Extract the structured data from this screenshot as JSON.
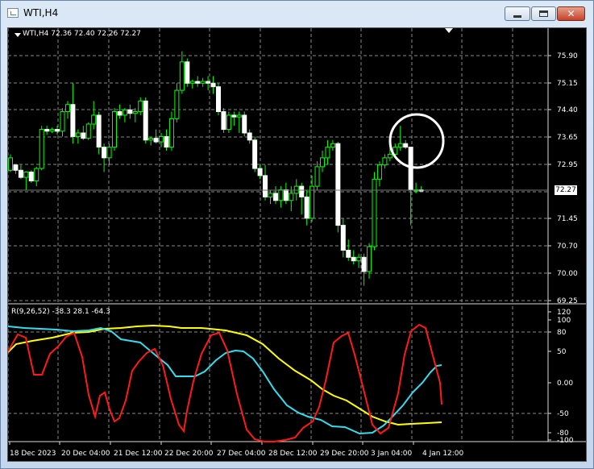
{
  "window": {
    "title": "WTI,H4"
  },
  "chart": {
    "header": "WTI,H4  72.36 72.40 72.26 72.27",
    "current_price_label": "72.27",
    "price_axis": [
      "75.90",
      "75.15",
      "74.40",
      "73.65",
      "72.95",
      "71.45",
      "70.70",
      "70.00",
      "69.25"
    ],
    "time_axis": [
      "18 Dec 2023",
      "20 Dec 04:00",
      "21 Dec 12:00",
      "22 Dec 20:00",
      "27 Dec 04:00",
      "28 Dec 12:00",
      "29 Dec 20:00",
      "3 Jan 04:00",
      "4 Jan 12:00"
    ]
  },
  "indicator": {
    "header": "R(9,26,52) -38.3 28.1 -64.3",
    "axis": [
      "120",
      "100",
      "80",
      "50",
      "0.00",
      "-50",
      "-80",
      "-100"
    ]
  },
  "colors": {
    "bull": "#00ff00",
    "bear": "#ffffff",
    "red": "#ff1a1a",
    "yellow": "#ffff00",
    "cyan": "#33ddee",
    "grid": "#8a8a8a",
    "highlight_circle": "#ffffff"
  },
  "chart_data": {
    "type": "candlestick",
    "ylim": [
      69.25,
      76.3
    ],
    "candles": [
      [
        72.85,
        73.3,
        72.8,
        73.2
      ],
      [
        73.0,
        72.96,
        72.75,
        72.85
      ],
      [
        72.85,
        73.0,
        72.6,
        72.65
      ],
      [
        72.65,
        72.82,
        72.3,
        72.8
      ],
      [
        72.8,
        72.85,
        72.5,
        72.55
      ],
      [
        72.55,
        72.95,
        72.4,
        72.9
      ],
      [
        72.9,
        74.1,
        72.85,
        74.0
      ],
      [
        74.0,
        74.1,
        73.85,
        73.95
      ],
      [
        73.95,
        74.05,
        73.9,
        74.0
      ],
      [
        74.0,
        74.1,
        73.85,
        73.95
      ],
      [
        73.95,
        74.6,
        73.8,
        74.5
      ],
      [
        74.5,
        74.8,
        74.3,
        74.7
      ],
      [
        74.7,
        75.3,
        73.6,
        73.8
      ],
      [
        73.8,
        74.0,
        73.6,
        73.9
      ],
      [
        73.9,
        74.1,
        73.7,
        73.75
      ],
      [
        73.75,
        74.2,
        73.7,
        74.15
      ],
      [
        74.15,
        74.8,
        74.0,
        74.4
      ],
      [
        74.4,
        74.5,
        73.3,
        73.5
      ],
      [
        73.5,
        73.6,
        72.8,
        73.2
      ],
      [
        73.2,
        73.6,
        73.0,
        73.5
      ],
      [
        73.5,
        74.6,
        73.4,
        74.5
      ],
      [
        74.5,
        74.7,
        74.3,
        74.4
      ],
      [
        74.4,
        74.6,
        74.2,
        74.55
      ],
      [
        74.55,
        74.7,
        74.3,
        74.45
      ],
      [
        74.45,
        74.6,
        74.2,
        74.5
      ],
      [
        74.5,
        74.9,
        74.4,
        74.8
      ],
      [
        74.8,
        74.9,
        73.6,
        73.7
      ],
      [
        73.7,
        73.8,
        73.55,
        73.75
      ],
      [
        73.75,
        74.0,
        73.6,
        73.65
      ],
      [
        73.65,
        73.9,
        73.5,
        73.8
      ],
      [
        73.8,
        74.0,
        73.4,
        73.5
      ],
      [
        73.5,
        74.5,
        73.4,
        74.3
      ],
      [
        74.3,
        75.3,
        74.2,
        75.1
      ],
      [
        75.1,
        76.2,
        75.0,
        75.9
      ],
      [
        75.9,
        76.0,
        75.2,
        75.3
      ],
      [
        75.3,
        75.4,
        75.15,
        75.35
      ],
      [
        75.35,
        75.5,
        75.2,
        75.3
      ],
      [
        75.3,
        75.45,
        75.2,
        75.35
      ],
      [
        75.35,
        75.5,
        75.1,
        75.3
      ],
      [
        75.3,
        75.5,
        75.0,
        75.2
      ],
      [
        75.2,
        75.3,
        74.4,
        74.5
      ],
      [
        74.5,
        74.6,
        73.9,
        74.0
      ],
      [
        74.0,
        74.5,
        73.9,
        74.4
      ],
      [
        74.4,
        74.5,
        74.1,
        74.35
      ],
      [
        74.35,
        74.5,
        73.9,
        74.4
      ],
      [
        74.4,
        74.5,
        73.8,
        73.9
      ],
      [
        73.9,
        74.0,
        73.6,
        73.7
      ],
      [
        73.7,
        73.8,
        72.8,
        72.9
      ],
      [
        72.9,
        73.0,
        72.6,
        72.7
      ],
      [
        72.7,
        73.0,
        72.0,
        72.1
      ],
      [
        72.1,
        72.3,
        71.9,
        72.2
      ],
      [
        72.2,
        72.4,
        71.9,
        72.0
      ],
      [
        72.0,
        72.4,
        71.8,
        72.3
      ],
      [
        72.3,
        72.5,
        71.9,
        72.0
      ],
      [
        72.0,
        72.4,
        71.7,
        72.2
      ],
      [
        72.2,
        72.6,
        72.0,
        72.4
      ],
      [
        72.4,
        72.5,
        71.6,
        72.1
      ],
      [
        72.1,
        72.3,
        71.3,
        71.5
      ],
      [
        71.5,
        72.7,
        71.4,
        72.4
      ],
      [
        72.4,
        73.1,
        72.3,
        72.95
      ],
      [
        72.95,
        73.4,
        72.8,
        73.2
      ],
      [
        73.2,
        73.7,
        73.0,
        73.5
      ],
      [
        73.5,
        73.7,
        73.4,
        73.6
      ],
      [
        73.6,
        73.65,
        71.1,
        71.3
      ],
      [
        71.3,
        71.5,
        70.4,
        70.6
      ],
      [
        70.6,
        70.9,
        70.3,
        70.4
      ],
      [
        70.4,
        70.6,
        70.2,
        70.3
      ],
      [
        70.3,
        70.5,
        70.1,
        70.4
      ],
      [
        70.4,
        70.5,
        69.6,
        70.0
      ],
      [
        70.0,
        70.8,
        69.8,
        70.7
      ],
      [
        70.7,
        72.8,
        70.6,
        72.6
      ],
      [
        72.6,
        73.1,
        72.4,
        73.0
      ],
      [
        73.0,
        73.3,
        72.9,
        73.2
      ],
      [
        73.2,
        73.5,
        73.1,
        73.3
      ],
      [
        73.3,
        73.6,
        73.2,
        73.5
      ],
      [
        73.5,
        74.1,
        73.4,
        73.6
      ],
      [
        73.6,
        73.7,
        73.45,
        73.5
      ],
      [
        73.5,
        73.5,
        71.3,
        72.3
      ],
      [
        72.3,
        72.5,
        72.2,
        72.3
      ],
      [
        72.3,
        72.4,
        72.26,
        72.27
      ]
    ],
    "series": [
      {
        "name": "9",
        "color": "#ff1a1a"
      },
      {
        "name": "26",
        "color": "#33ddee"
      },
      {
        "name": "52",
        "color": "#ffff00"
      }
    ]
  }
}
